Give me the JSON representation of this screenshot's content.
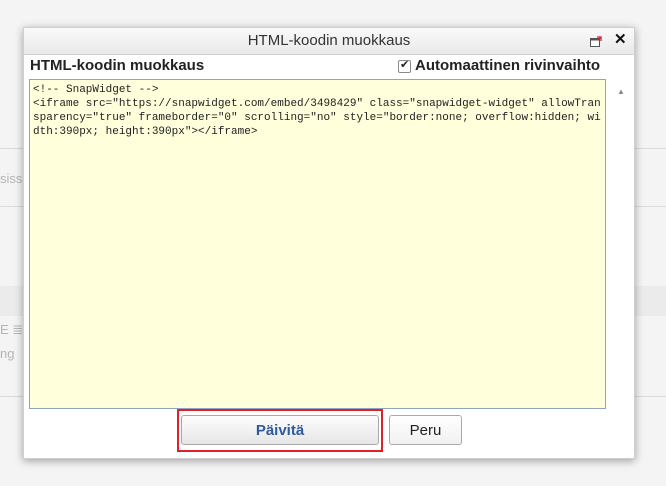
{
  "background": {
    "fragment_1": "siss",
    "fragment_2": "E ≣",
    "fragment_3": "ng"
  },
  "dialog": {
    "title": "HTML-koodin muokkaus",
    "heading": "HTML-koodin muokkaus",
    "wrap_label": "Automaattinen rivinvaihto",
    "wrap_checked": true,
    "editor_content": "<!-- SnapWidget -->\n<iframe src=\"https://snapwidget.com/embed/3498429\" class=\"snapwidget-widget\" allowTransparency=\"true\" frameborder=\"0\" scrolling=\"no\" style=\"border:none; overflow:hidden; width:390px; height:390px\"></iframe>",
    "update_label": "Päivitä",
    "cancel_label": "Peru"
  },
  "colors": {
    "editor_bg": "#ffffdc",
    "update_text": "#2f5aa0",
    "highlight": "#e0202a"
  },
  "icons": [
    "maximize-icon",
    "close-icon",
    "checkbox-check-icon",
    "scroll-up-icon",
    "scroll-down-icon"
  ]
}
